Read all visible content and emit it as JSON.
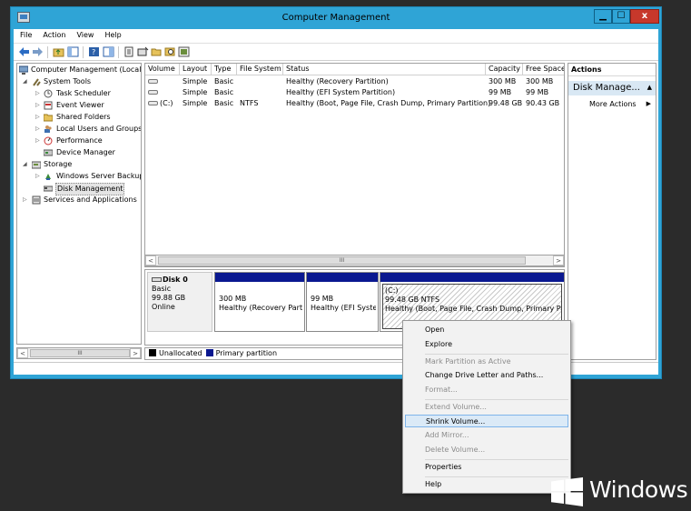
{
  "window": {
    "title": "Computer Management"
  },
  "window_controls": {
    "minimize": "▁",
    "maximize": "☐",
    "close": "x"
  },
  "menu": [
    "File",
    "Action",
    "View",
    "Help"
  ],
  "tree": {
    "root": "Computer Management (Local",
    "items": [
      {
        "label": "System Tools",
        "icon": "tools-icon"
      },
      {
        "label": "Task Scheduler",
        "icon": "clock-icon"
      },
      {
        "label": "Event Viewer",
        "icon": "event-viewer-icon"
      },
      {
        "label": "Shared Folders",
        "icon": "shared-folder-icon"
      },
      {
        "label": "Local Users and Groups",
        "icon": "users-icon"
      },
      {
        "label": "Performance",
        "icon": "performance-icon"
      },
      {
        "label": "Device Manager",
        "icon": "device-manager-icon"
      },
      {
        "label": "Storage",
        "icon": "storage-icon"
      },
      {
        "label": "Windows Server Backup",
        "icon": "backup-icon"
      },
      {
        "label": "Disk Management",
        "icon": "disk-icon"
      },
      {
        "label": "Services and Applications",
        "icon": "services-icon"
      }
    ]
  },
  "volumes": {
    "columns": [
      "Volume",
      "Layout",
      "Type",
      "File System",
      "Status",
      "Capacity",
      "Free Space"
    ],
    "rows": [
      {
        "volume": "",
        "layout": "Simple",
        "type": "Basic",
        "fs": "",
        "status": "Healthy (Recovery Partition)",
        "capacity": "300 MB",
        "free": "300 MB"
      },
      {
        "volume": "",
        "layout": "Simple",
        "type": "Basic",
        "fs": "",
        "status": "Healthy (EFI System Partition)",
        "capacity": "99 MB",
        "free": "99 MB"
      },
      {
        "volume": "(C:)",
        "layout": "Simple",
        "type": "Basic",
        "fs": "NTFS",
        "status": "Healthy (Boot, Page File, Crash Dump, Primary Partition)",
        "capacity": "99.48 GB",
        "free": "90.43 GB"
      }
    ]
  },
  "disk": {
    "name": "Disk 0",
    "type": "Basic",
    "size": "99.88 GB",
    "state": "Online",
    "partitions": [
      {
        "label": "",
        "size": "300 MB",
        "status": "Healthy (Recovery Partit"
      },
      {
        "label": "",
        "size": "99 MB",
        "status": "Healthy (EFI Syster"
      },
      {
        "label": "(C:)",
        "size": "99.48 GB NTFS",
        "status": "Healthy (Boot, Page File, Crash Dump, Primary Part"
      }
    ]
  },
  "legend": {
    "unallocated": "Unallocated",
    "primary": "Primary partition",
    "unallocated_color": "#000000",
    "primary_color": "#0a1890"
  },
  "actions": {
    "header": "Actions",
    "section": "Disk Manage...",
    "more": "More Actions"
  },
  "context_menu": {
    "items": [
      {
        "label": "Open",
        "enabled": true
      },
      {
        "label": "Explore",
        "enabled": true
      },
      {
        "label": "Mark Partition as Active",
        "enabled": false
      },
      {
        "label": "Change Drive Letter and Paths...",
        "enabled": true
      },
      {
        "label": "Format...",
        "enabled": false
      },
      {
        "label": "Extend Volume...",
        "enabled": false
      },
      {
        "label": "Shrink Volume...",
        "enabled": true,
        "highlighted": true
      },
      {
        "label": "Add Mirror...",
        "enabled": false
      },
      {
        "label": "Delete Volume...",
        "enabled": false
      },
      {
        "label": "Properties",
        "enabled": true
      },
      {
        "label": "Help",
        "enabled": true
      }
    ]
  },
  "branding": {
    "text": "Windows"
  },
  "colors": {
    "titlebar": "#2fa4d6",
    "close_button": "#c7382b",
    "desktop": "#2b2b2b",
    "partition_bar": "#0a1890"
  }
}
